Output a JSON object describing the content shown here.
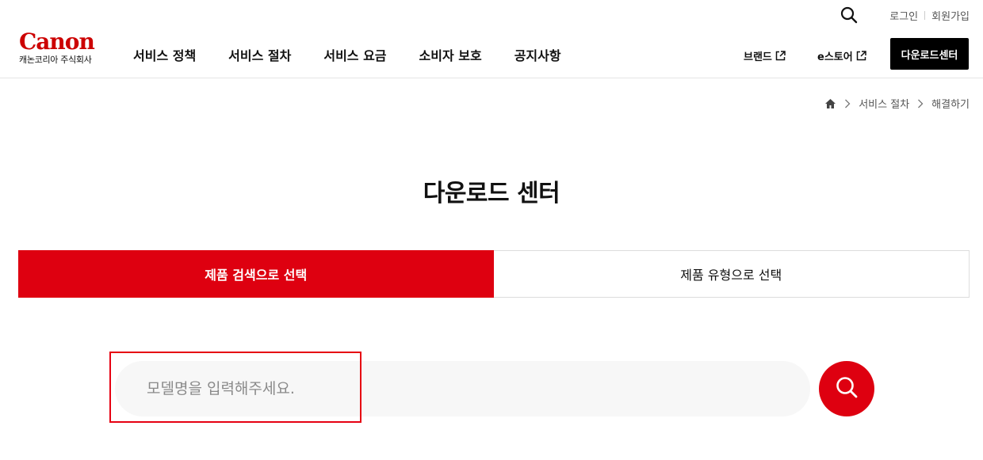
{
  "header": {
    "logo": {
      "wordmark": "Canon",
      "company": "캐논코리아 주식회사"
    },
    "gnb": [
      "서비스 정책",
      "서비스 절차",
      "서비스 요금",
      "소비자 보호",
      "공지사항"
    ],
    "util": {
      "login": "로그인",
      "signup": "회원가입"
    },
    "external_links": {
      "brand": "브랜드",
      "store": "e스토어"
    },
    "download_center_button": "다운로드센터"
  },
  "breadcrumb": {
    "level1": "서비스 절차",
    "level2": "해결하기"
  },
  "page_title": "다운로드 센터",
  "tabs": [
    {
      "label": "제품 검색으로 선택",
      "active": true
    },
    {
      "label": "제품 유형으로 선택",
      "active": false
    }
  ],
  "search": {
    "placeholder": "모델명을 입력해주세요.",
    "value": ""
  },
  "colors": {
    "brand_red": "#de0010",
    "logo_red": "#cc0000",
    "highlight": "#e60012"
  },
  "icons": [
    "search-icon",
    "external-link-icon",
    "home-icon",
    "chevron-right-icon"
  ]
}
